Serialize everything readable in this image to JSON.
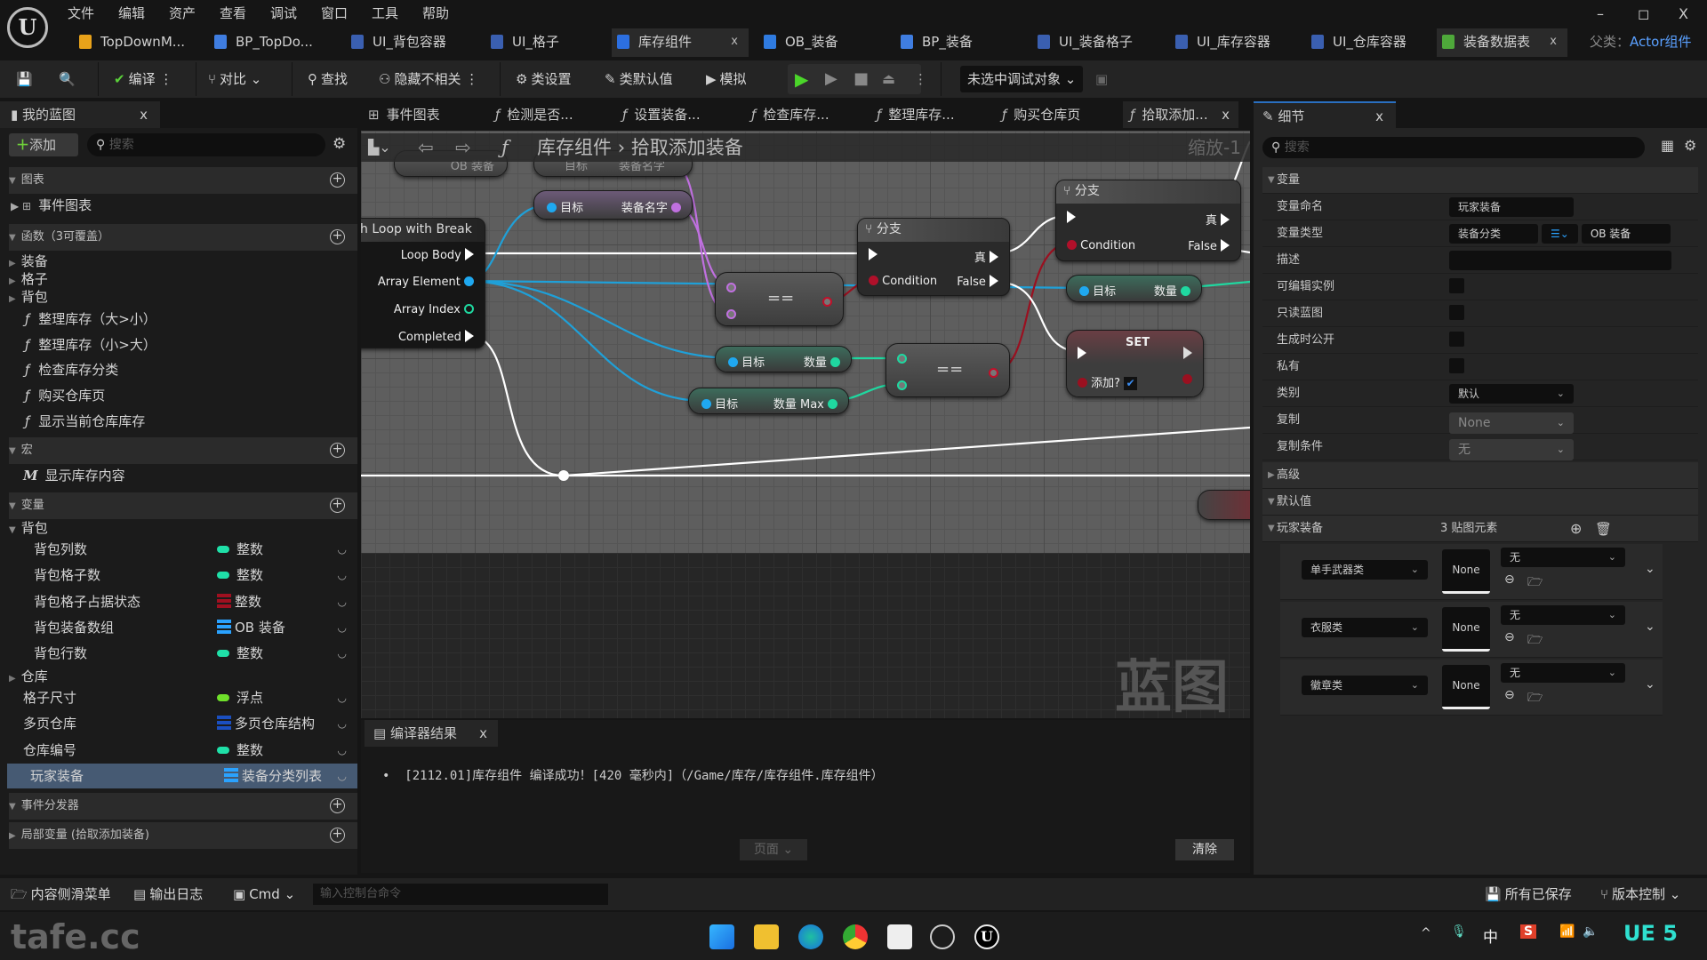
{
  "menu": [
    "文件",
    "编辑",
    "资产",
    "查看",
    "调试",
    "窗口",
    "工具",
    "帮助"
  ],
  "window_controls": {
    "minimize": "–",
    "restore": "◻",
    "close": "X"
  },
  "tabs": [
    {
      "label": "TopDownM...",
      "icon": "level-icon",
      "color": "#e8a21a"
    },
    {
      "label": "BP_TopDo...",
      "icon": "pawn-icon",
      "color": "#3f7de0"
    },
    {
      "label": "UI_背包容器",
      "icon": "widget-icon",
      "color": "#3a5fb0"
    },
    {
      "label": "UI_格子",
      "icon": "widget-icon",
      "color": "#3a5fb0"
    },
    {
      "label": "库存组件",
      "icon": "component-icon",
      "color": "#2c6fe0",
      "active": true,
      "close": "x"
    },
    {
      "label": "OB_装备",
      "icon": "object-icon",
      "color": "#2f7be0"
    },
    {
      "label": "BP_装备",
      "icon": "actor-icon",
      "color": "#3f7de0"
    },
    {
      "label": "UI_装备格子",
      "icon": "widget-icon",
      "color": "#3a5fb0"
    },
    {
      "label": "UI_库存容器",
      "icon": "widget-icon",
      "color": "#3a5fb0"
    },
    {
      "label": "UI_仓库容器",
      "icon": "widget-icon",
      "color": "#3a5fb0"
    },
    {
      "label": "装备数据表",
      "icon": "datatable-icon",
      "color": "#4ea83a",
      "active": true,
      "close": "x"
    }
  ],
  "parent_class": {
    "label": "父类：",
    "value": "Actor组件"
  },
  "toolbar": {
    "compile": "编译",
    "diff": "对比",
    "find": "查找",
    "hide_unrelated": "隐藏不相关",
    "class_settings": "类设置",
    "class_defaults": "类默认值",
    "simulate": "模拟",
    "debug_target": "未选中调试对象"
  },
  "my_blueprint": {
    "title": "我的蓝图",
    "close": "x",
    "add": "添加",
    "search_placeholder": "搜索",
    "graphs_header": "图表",
    "event_graph": "事件图表",
    "functions_header": "函数（3可覆盖）",
    "function_groups": [
      "装备",
      "格子",
      "背包"
    ],
    "functions": [
      "整理库存（大>小）",
      "整理库存（小>大）",
      "检查库存分类",
      "购买仓库页",
      "显示当前仓库库存"
    ],
    "macros_header": "宏",
    "macros": [
      "显示库存内容"
    ],
    "variables_header": "变量",
    "var_group_backpack": "背包",
    "backpack_vars": [
      {
        "name": "背包列数",
        "type": "整数",
        "icon": "int-pill",
        "color": "#1fe0a8"
      },
      {
        "name": "背包格子数",
        "type": "整数",
        "icon": "int-pill",
        "color": "#1fe0a8"
      },
      {
        "name": "背包格子占据状态",
        "type": "整数",
        "icon": "map-icon",
        "color": "#a01020"
      },
      {
        "name": "背包装备数组",
        "type": "OB 装备",
        "icon": "array-icon",
        "color": "#2aa2ff"
      },
      {
        "name": "背包行数",
        "type": "整数",
        "icon": "int-pill",
        "color": "#1fe0a8"
      }
    ],
    "var_group_warehouse": "仓库",
    "vars": [
      {
        "name": "格子尺寸",
        "type": "浮点",
        "icon": "float-pill",
        "color": "#6fe02a"
      },
      {
        "name": "多页仓库",
        "type": "多页仓库结构",
        "icon": "struct-array-icon",
        "color": "#1b4fc0"
      },
      {
        "name": "仓库编号",
        "type": "整数",
        "icon": "int-pill",
        "color": "#1fe0a8"
      },
      {
        "name": "玩家装备",
        "type": "装备分类列表",
        "icon": "map-icon",
        "color": "#2aa2ff",
        "selected": true
      }
    ],
    "dispatchers_header": "事件分发器",
    "locals_header": "局部变量 (拾取添加装备)"
  },
  "graph_tabs": [
    "事件图表",
    "检测是否...",
    "设置装备...",
    "检查库存...",
    "整理库存...",
    "购买仓库页",
    "拾取添加..."
  ],
  "graph_tab_close": "x",
  "breadcrumb": {
    "root": "库存组件",
    "sep": "›",
    "current": "拾取添加装备",
    "zoom": "缩放-1"
  },
  "watermark": "蓝图",
  "nodes": {
    "foreach": {
      "title": "h Loop with Break",
      "pins": [
        "Loop Body",
        "Array Element",
        "Array Index",
        "Completed"
      ]
    },
    "top_var": "OB 装备",
    "target": "目标",
    "equip_name": "装备名字",
    "count": "数量",
    "count_max": "数量 Max",
    "equal": "==",
    "branch": "分支",
    "true": "真",
    "condition": "Condition",
    "false": "False",
    "set": "SET",
    "set_pin": "添加?",
    "set_value": true
  },
  "details": {
    "title": "细节",
    "close": "x",
    "search_placeholder": "搜索",
    "variable_header": "变量",
    "rows": {
      "name_label": "变量命名",
      "name_value": "玩家装备",
      "type_label": "变量类型",
      "type_key": "装备分类",
      "type_value": "OB 装备",
      "desc_label": "描述",
      "desc_value": "",
      "instance_editable": "可编辑实例",
      "readonly": "只读蓝图",
      "expose_spawn": "生成时公开",
      "private": "私有",
      "category_label": "类别",
      "category_value": "默认",
      "replication_label": "复制",
      "replication_value": "None",
      "repcond_label": "复制条件",
      "repcond_value": "无"
    },
    "checkbox_values": {
      "instance_editable": false,
      "readonly": false,
      "expose_spawn": false,
      "private": false
    },
    "advanced_header": "高级",
    "defaults_header": "默认值",
    "map": {
      "name": "玩家装备",
      "count": "3 贴图元素",
      "entries": [
        {
          "key": "单手武器类",
          "thumb": "None",
          "value": "无"
        },
        {
          "key": "衣服类",
          "thumb": "None",
          "value": "无"
        },
        {
          "key": "徽章类",
          "thumb": "None",
          "value": "无"
        }
      ]
    }
  },
  "compiler": {
    "title": "编译器结果",
    "close": "x",
    "message": "[2112.01]库存组件 编译成功！[420 毫秒内]（/Game/库存/库存组件.库存组件）",
    "page": "页面",
    "clear": "清除"
  },
  "statusbar": {
    "content_drawer": "内容侧滑菜单",
    "output_log": "输出日志",
    "cmd": "Cmd",
    "console_placeholder": "输入控制台命令",
    "saved": "所有已保存",
    "source_control": "版本控制"
  },
  "taskbar": {
    "watermark": "tafe.cc",
    "ime": "中",
    "ue": "UE 5"
  }
}
